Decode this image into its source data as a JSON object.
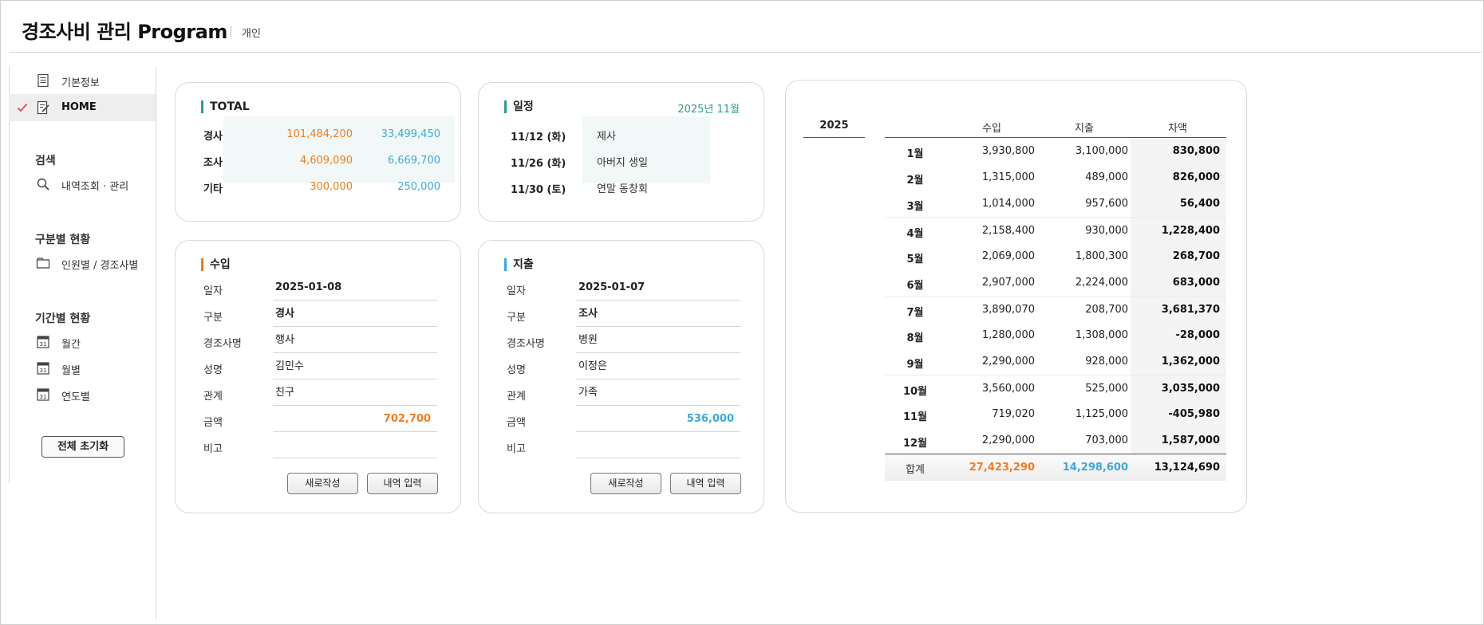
{
  "app": {
    "title": "경조사비 관리 Program",
    "subtitle": "개인"
  },
  "sidebar": {
    "top_items": [
      {
        "label": "기본정보",
        "icon": "document-icon"
      },
      {
        "label": "HOME",
        "icon": "edit-note-icon",
        "active": true
      }
    ],
    "sections": {
      "search": {
        "title": "검색",
        "items": [
          {
            "label": "내역조회 · 관리",
            "icon": "search-icon"
          }
        ]
      },
      "by_category": {
        "title": "구분별 현황",
        "items": [
          {
            "label": "인원별 / 경조사별",
            "icon": "folder-icon"
          }
        ]
      },
      "by_period": {
        "title": "기간별 현황",
        "items": [
          {
            "label": "월간",
            "icon": "calendar-icon"
          },
          {
            "label": "월별",
            "icon": "calendar-icon"
          },
          {
            "label": "연도별",
            "icon": "calendar-icon"
          }
        ]
      }
    },
    "reset_label": "전체 초기화"
  },
  "total": {
    "title": "TOTAL",
    "rows": [
      {
        "label": "경사",
        "income": "101,484,200",
        "expense": "33,499,450"
      },
      {
        "label": "조사",
        "income": "4,609,090",
        "expense": "6,669,700"
      },
      {
        "label": "기타",
        "income": "300,000",
        "expense": "250,000"
      }
    ]
  },
  "schedule": {
    "title": "일정",
    "month": "2025년 11월",
    "rows": [
      {
        "date": "11/12 (화)",
        "event": "제사"
      },
      {
        "date": "11/26 (화)",
        "event": "아버지 생일"
      },
      {
        "date": "11/30 (토)",
        "event": "연말 동창회"
      }
    ]
  },
  "income_form": {
    "title": "수입",
    "fields": [
      {
        "label": "일자",
        "value": "2025-01-08"
      },
      {
        "label": "구분",
        "value": "경사"
      },
      {
        "label": "경조사명",
        "value": "행사"
      },
      {
        "label": "성명",
        "value": "김민수"
      },
      {
        "label": "관계",
        "value": "친구"
      },
      {
        "label": "금액",
        "value": "702,700"
      },
      {
        "label": "비고",
        "value": ""
      }
    ],
    "new_label": "새로작성",
    "submit_label": "내역 입력"
  },
  "expense_form": {
    "title": "지출",
    "fields": [
      {
        "label": "일자",
        "value": "2025-01-07"
      },
      {
        "label": "구분",
        "value": "조사"
      },
      {
        "label": "경조사명",
        "value": "병원"
      },
      {
        "label": "성명",
        "value": "이정은"
      },
      {
        "label": "관계",
        "value": "가족"
      },
      {
        "label": "금액",
        "value": "536,000"
      },
      {
        "label": "비고",
        "value": ""
      }
    ],
    "new_label": "새로작성",
    "submit_label": "내역 입력"
  },
  "yearly": {
    "year": "2025",
    "headers": {
      "income": "수입",
      "expense": "지출",
      "diff": "차액"
    },
    "rows": [
      {
        "month": "1월",
        "income": "3,930,800",
        "expense": "3,100,000",
        "diff": "830,800"
      },
      {
        "month": "2월",
        "income": "1,315,000",
        "expense": "489,000",
        "diff": "826,000"
      },
      {
        "month": "3월",
        "income": "1,014,000",
        "expense": "957,600",
        "diff": "56,400"
      },
      {
        "month": "4월",
        "income": "2,158,400",
        "expense": "930,000",
        "diff": "1,228,400"
      },
      {
        "month": "5월",
        "income": "2,069,000",
        "expense": "1,800,300",
        "diff": "268,700"
      },
      {
        "month": "6월",
        "income": "2,907,000",
        "expense": "2,224,000",
        "diff": "683,000"
      },
      {
        "month": "7월",
        "income": "3,890,070",
        "expense": "208,700",
        "diff": "3,681,370"
      },
      {
        "month": "8월",
        "income": "1,280,000",
        "expense": "1,308,000",
        "diff": "-28,000"
      },
      {
        "month": "9월",
        "income": "2,290,000",
        "expense": "928,000",
        "diff": "1,362,000"
      },
      {
        "month": "10월",
        "income": "3,560,000",
        "expense": "525,000",
        "diff": "3,035,000"
      },
      {
        "month": "11월",
        "income": "719,020",
        "expense": "1,125,000",
        "diff": "-405,980"
      },
      {
        "month": "12월",
        "income": "2,290,000",
        "expense": "703,000",
        "diff": "1,587,000"
      }
    ],
    "total": {
      "label": "합계",
      "income": "27,423,290",
      "expense": "14,298,600",
      "diff": "13,124,690"
    }
  },
  "colors": {
    "income": "#ef7d22",
    "expense": "#3ba9d9",
    "accent": "#2a9d8f",
    "check": "#e0565b"
  }
}
